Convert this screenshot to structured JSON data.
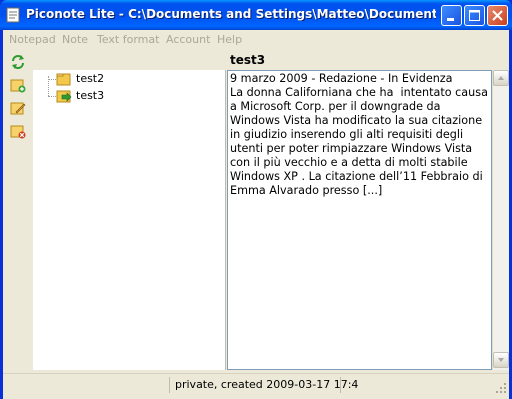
{
  "window": {
    "title": "Piconote Lite - C:\\Documents and Settings\\Matteo\\Documenti\\No..."
  },
  "menu": [
    {
      "label": "Notepad"
    },
    {
      "label": "Note"
    },
    {
      "label": "Text format"
    },
    {
      "label": "Account"
    },
    {
      "label": "Help"
    }
  ],
  "toolbar": {
    "icons": [
      "refresh-icon",
      "new-note-icon",
      "edit-note-icon",
      "delete-note-icon"
    ]
  },
  "tree": {
    "items": [
      {
        "label": "test2",
        "icon": "folder-icon"
      },
      {
        "label": "test3",
        "icon": "folder-arrow-icon",
        "selected": true
      }
    ]
  },
  "note": {
    "title": "test3",
    "body": "9 marzo 2009 - Redazione - In Evidenza\nLa donna Californiana che ha  intentato causa a Microsoft Corp. per il downgrade da Windows Vista ha modificato la sua citazione in giudizio inserendo gli alti requisiti degli utenti per poter rimpiazzare Windows Vista con il più vecchio e a detta di molti stabile Windows XP . La citazione dell’11 Febbraio di Emma Alvarado presso [...]"
  },
  "status": {
    "text": "private, created 2009-03-17 17:4"
  },
  "colors": {
    "titlebar": "#0053ee",
    "face": "#ece9d8",
    "menu_disabled": "#aca899"
  }
}
